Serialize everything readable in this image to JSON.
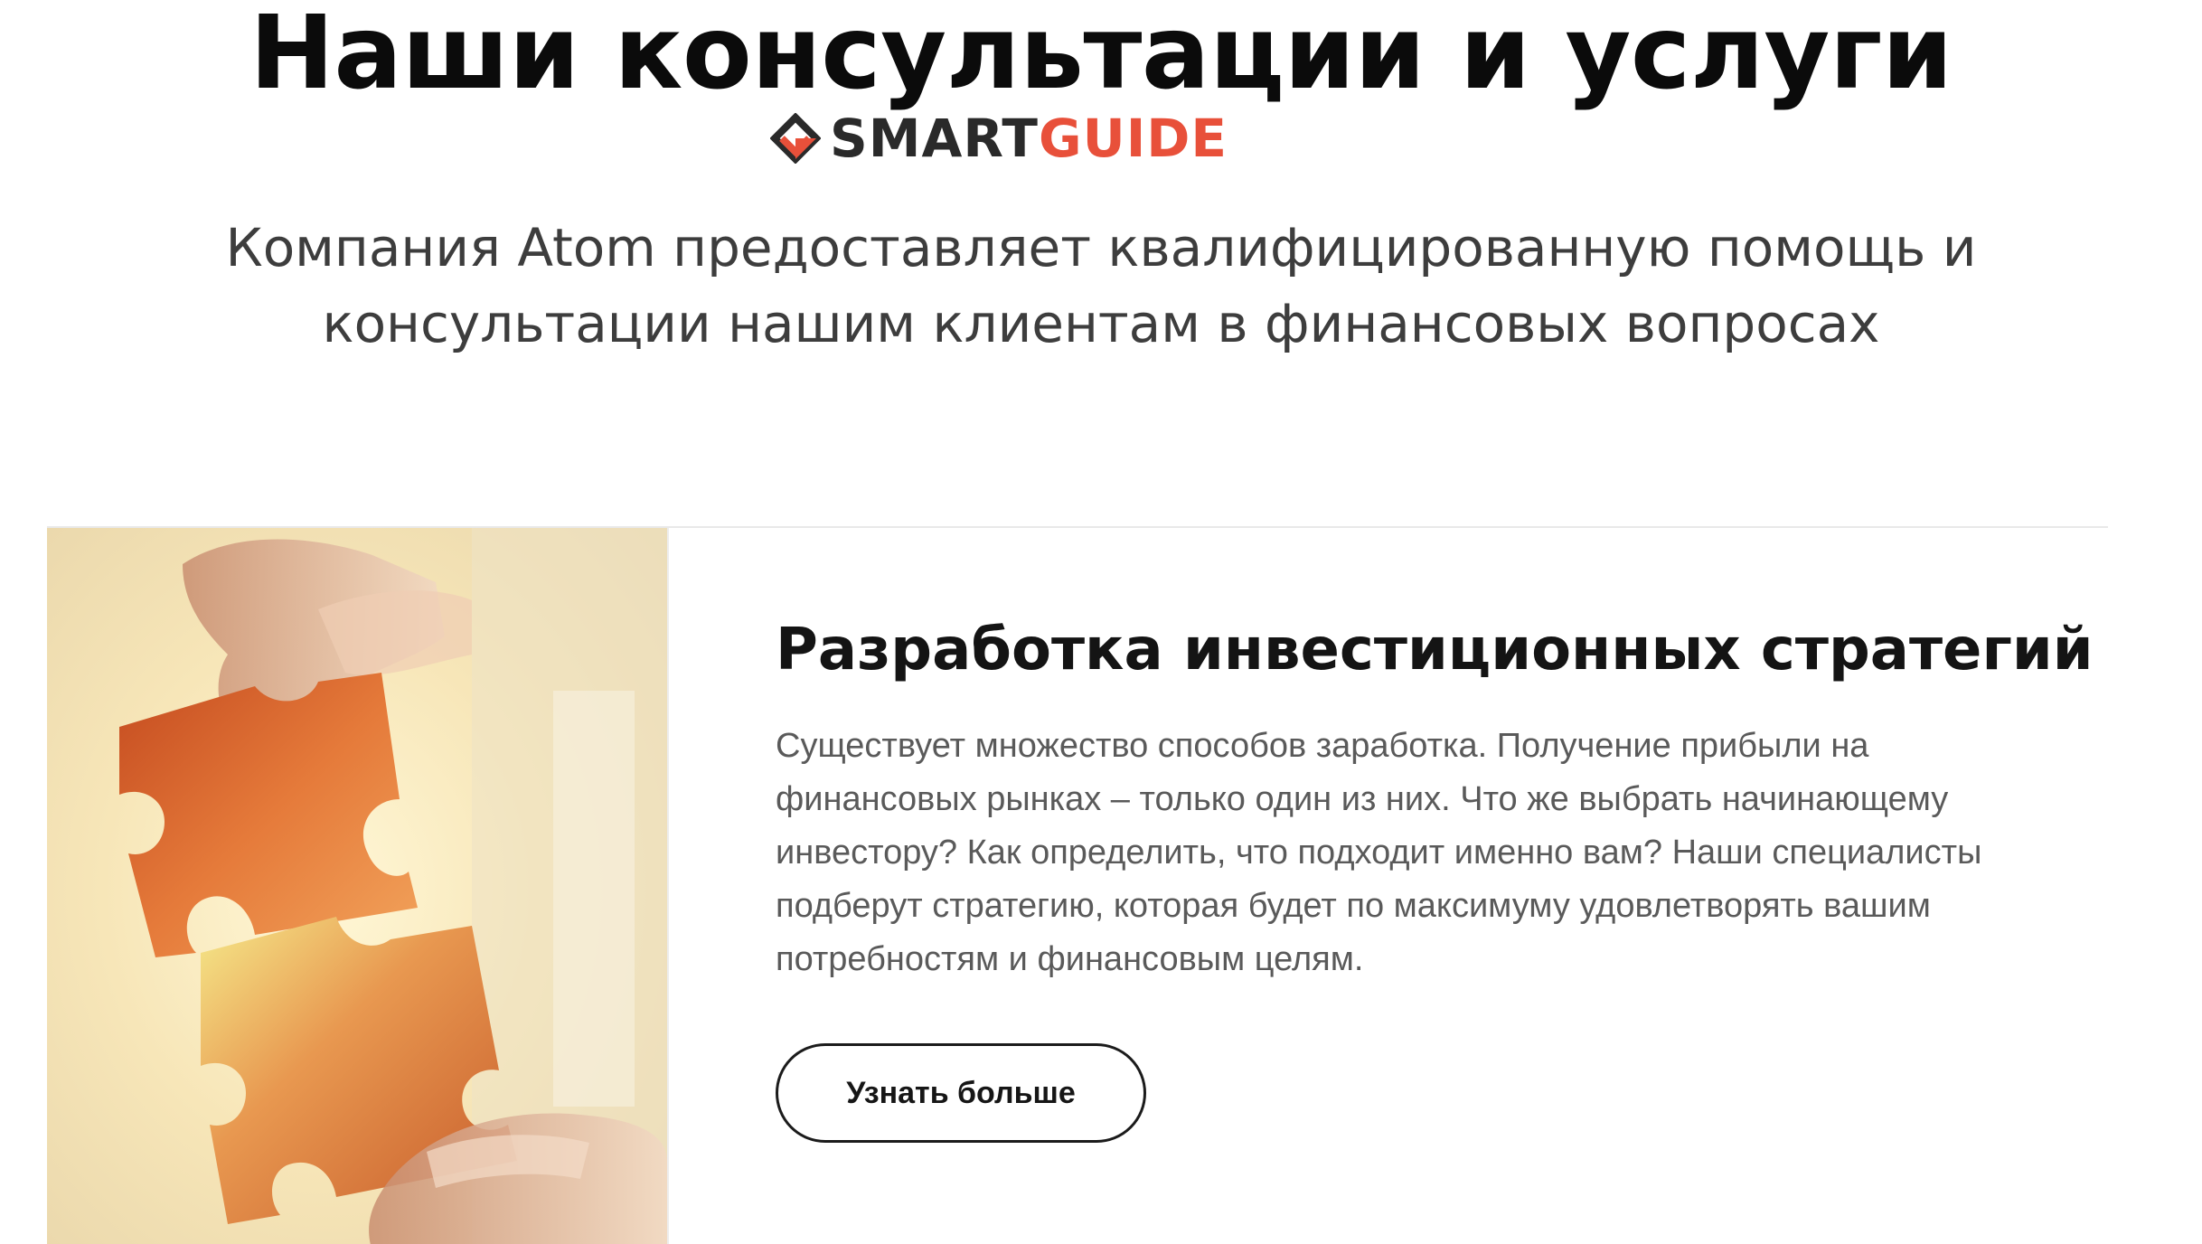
{
  "header": {
    "title": "Наши консультации и услуги",
    "brand": {
      "smart": "SMART",
      "guide": "GUIDE",
      "icon": "diamond-logo-icon",
      "colors": {
        "dark": "#2a2a2a",
        "accent": "#e8503a"
      }
    },
    "lead_line1": "Компания Atom предоставляет квалифицированную помощь и",
    "lead_line2": "консультации нашим клиентам в финансовых вопросах"
  },
  "service_card": {
    "image": "puzzle-pieces-hands-image",
    "title": "Разработка инвестиционных стратегий",
    "text_lines": [
      "Существует множество способов заработка. Получение прибыли на",
      "финансовых рынках – только один из них. Что же выбрать начинающему",
      "инвестору? Как определить, что подходит именно вам? Наши специалисты",
      "подберут стратегию, которая будет по максимуму удовлетворять вашим",
      "потребностям и финансовым целям."
    ],
    "button_label": "Узнать больше"
  }
}
